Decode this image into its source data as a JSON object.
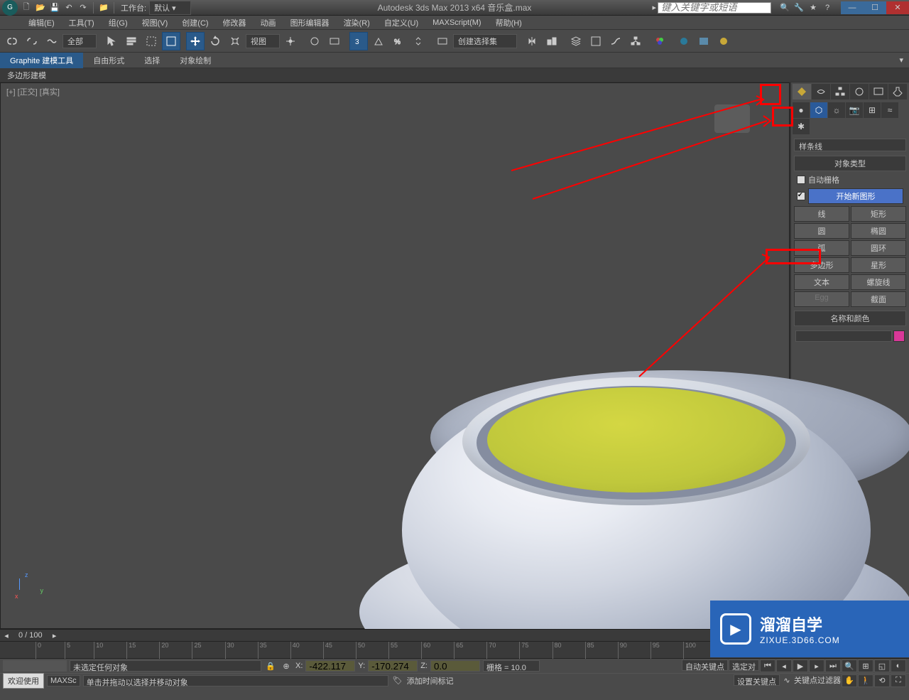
{
  "titlebar": {
    "workspace_label": "工作台:",
    "workspace_value": "默认",
    "app_title": "Autodesk 3ds Max  2013 x64   音乐盒.max",
    "search_placeholder": "键入关键字或短语"
  },
  "menu": {
    "items": [
      "编辑(E)",
      "工具(T)",
      "组(G)",
      "视图(V)",
      "创建(C)",
      "修改器",
      "动画",
      "图形编辑器",
      "渲染(R)",
      "自定义(U)",
      "MAXScript(M)",
      "帮助(H)"
    ]
  },
  "toolbar": {
    "selection_filter": "全部",
    "ref_coord": "视图",
    "named_sel": "创建选择集"
  },
  "ribbon": {
    "tabs": [
      "Graphite 建模工具",
      "自由形式",
      "选择",
      "对象绘制"
    ],
    "sub": "多边形建模"
  },
  "viewport": {
    "label": "[+] [正交] [真实]"
  },
  "command_panel": {
    "category_dd": "样条线",
    "object_type_header": "对象类型",
    "auto_grid": "自动栅格",
    "start_new_shape": "开始新图形",
    "buttons": [
      [
        "线",
        "矩形"
      ],
      [
        "圆",
        "椭圆"
      ],
      [
        "弧",
        "圆环"
      ],
      [
        "多边形",
        "星形"
      ],
      [
        "文本",
        "螺旋线"
      ],
      [
        "Egg",
        "截面"
      ]
    ],
    "name_color_header": "名称和颜色"
  },
  "timeline": {
    "frame_display": "0 / 100",
    "marks": [
      "0",
      "5",
      "10",
      "15",
      "20",
      "25",
      "30",
      "35",
      "40",
      "45",
      "50",
      "55",
      "60",
      "65",
      "70",
      "75",
      "80",
      "85",
      "90",
      "95",
      "100"
    ]
  },
  "status": {
    "sel_info": "未选定任何对象",
    "x_label": "X:",
    "x_val": "-422.117",
    "y_label": "Y:",
    "y_val": "-170.274",
    "z_label": "Z:",
    "z_val": "0.0",
    "grid_label": "栅格 = 10.0",
    "auto_key": "自动关键点",
    "selected_label": "选定对",
    "welcome": "欢迎使用",
    "maxscript": "MAXSc",
    "prompt": "单击并拖动以选择并移动对象",
    "add_time_tag": "添加时间标记",
    "set_key": "设置关键点",
    "key_filters": "关键点过滤器"
  },
  "watermark": {
    "title": "溜溜自学",
    "url": "ZIXUE.3D66.COM"
  }
}
